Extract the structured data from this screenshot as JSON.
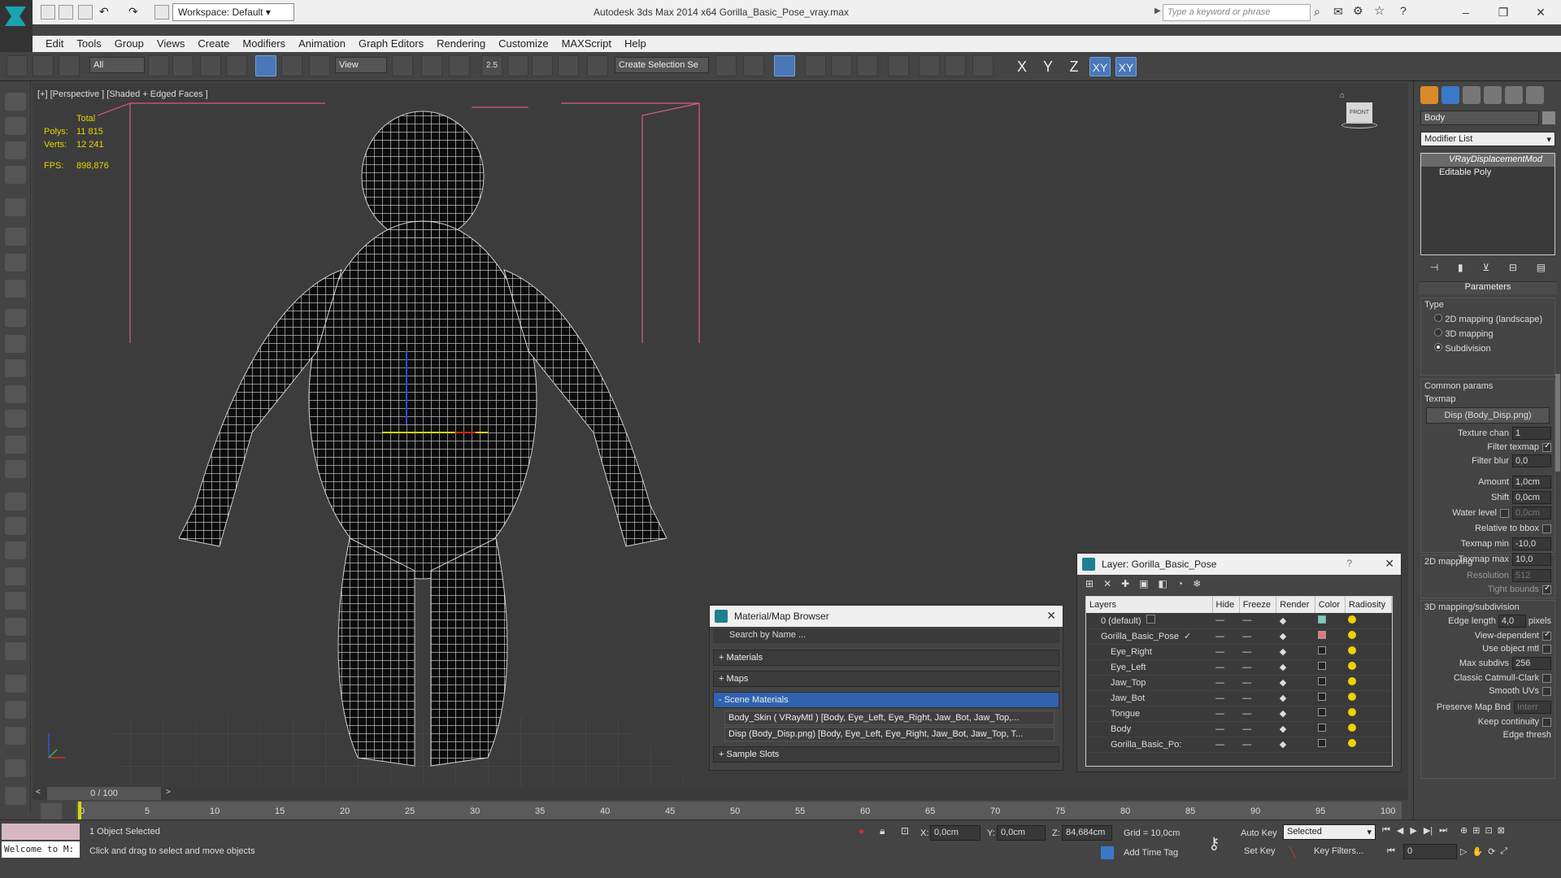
{
  "app": {
    "title": "Autodesk 3ds Max  2014 x64    Gorilla_Basic_Pose_vray.max",
    "workspace": "Workspace: Default",
    "search_placeholder": "Type a keyword or phrase"
  },
  "menu": [
    "Edit",
    "Tools",
    "Group",
    "Views",
    "Create",
    "Modifiers",
    "Animation",
    "Graph Editors",
    "Rendering",
    "Customize",
    "MAXScript",
    "Help"
  ],
  "toolbar": {
    "filter": "All",
    "refcoord": "View",
    "selset": "Create Selection Se",
    "snap2": "2.5",
    "axes": [
      "X",
      "Y",
      "Z",
      "XY",
      "XY"
    ]
  },
  "viewport": {
    "label": "[+] [Perspective ] [Shaded + Edged Faces ]",
    "stats": {
      "total": "Total",
      "polys_label": "Polys:",
      "polys": "11 815",
      "verts_label": "Verts:",
      "verts": "12 241",
      "fps_label": "FPS:",
      "fps": "898,876"
    },
    "viewcube": "FRONT"
  },
  "command_panel": {
    "object_name": "Body",
    "modifier_list": "Modifier List",
    "stack": [
      "VRayDisplacementMod",
      "Editable Poly"
    ],
    "params": {
      "title": "Parameters",
      "type_label": "Type",
      "types": [
        "2D mapping (landscape)",
        "3D mapping",
        "Subdivision"
      ],
      "selected_type": 2,
      "common": "Common params",
      "texmap_label": "Texmap",
      "texmap": "Disp (Body_Disp.png)",
      "texture_chan_label": "Texture chan",
      "texture_chan": "1",
      "filter_texmap": "Filter texmap",
      "filter_blur_label": "Filter blur",
      "filter_blur": "0,0",
      "amount_label": "Amount",
      "amount": "1,0cm",
      "shift_label": "Shift",
      "shift": "0,0cm",
      "water_label": "Water level",
      "water": "0,0cm",
      "relative": "Relative to bbox",
      "texmap_min_label": "Texmap min",
      "texmap_min": "-10,0",
      "texmap_max_label": "Texmap max",
      "texmap_max": "10,0",
      "mapping2d": "2D mapping",
      "resolution_label": "Resolution",
      "resolution": "512",
      "tight": "Tight bounds",
      "mapping3d": "3D mapping/subdivision",
      "edge_label": "Edge length",
      "edge": "4,0",
      "pixels": "pixels",
      "view_dep": "View-dependent",
      "use_obj": "Use object mtl",
      "max_subdivs_label": "Max subdivs",
      "max_subdivs": "256",
      "catmull": "Classic Catmull-Clark",
      "smooth_uvs": "Smooth UVs",
      "preserve_label": "Preserve Map Bnd",
      "preserve": "Interr",
      "keep": "Keep continuity",
      "edge_thresh": "Edge thresh"
    }
  },
  "material_browser": {
    "title": "Material/Map Browser",
    "search": "Search by Name ...",
    "sections": [
      "+ Materials",
      "+ Maps",
      "- Scene Materials",
      "+ Sample Slots"
    ],
    "items": [
      "Body_Skin  ( VRayMtl ) [Body, Eye_Left, Eye_Right, Jaw_Bot, Jaw_Top,...",
      "Disp (Body_Disp.png) [Body, Eye_Left, Eye_Right, Jaw_Bot, Jaw_Top, T..."
    ]
  },
  "layer_panel": {
    "title": "Layer: Gorilla_Basic_Pose",
    "help": "?",
    "headers": [
      "Layers",
      "Hide",
      "Freeze",
      "Render",
      "Color",
      "Radiosity"
    ],
    "rows": [
      {
        "name": "0 (default)",
        "color": "#6fd0c0",
        "indent": 0
      },
      {
        "name": "Gorilla_Basic_Pose",
        "color": "#e07a7a",
        "indent": 0
      },
      {
        "name": "Eye_Right",
        "color": "#222222",
        "indent": 1
      },
      {
        "name": "Eye_Left",
        "color": "#222222",
        "indent": 1
      },
      {
        "name": "Jaw_Top",
        "color": "#222222",
        "indent": 1
      },
      {
        "name": "Jaw_Bot",
        "color": "#222222",
        "indent": 1
      },
      {
        "name": "Tongue",
        "color": "#222222",
        "indent": 1
      },
      {
        "name": "Body",
        "color": "#222222",
        "indent": 1
      },
      {
        "name": "Gorilla_Basic_Po:",
        "color": "#222222",
        "indent": 1
      }
    ]
  },
  "timeline": {
    "frame": "0 / 100",
    "ticks": [
      "0",
      "5",
      "10",
      "15",
      "20",
      "25",
      "30",
      "35",
      "40",
      "45",
      "50",
      "55",
      "60",
      "65",
      "70",
      "75",
      "80",
      "85",
      "90",
      "95",
      "100"
    ]
  },
  "status": {
    "welcome": "Welcome to M:",
    "selected": "1 Object Selected",
    "hint": "Click and drag to select and move objects",
    "x_label": "X:",
    "x": "0,0cm",
    "y_label": "Y:",
    "y": "0,0cm",
    "z_label": "Z:",
    "z": "84,684cm",
    "grid": "Grid = 10,0cm",
    "add_time_tag": "Add Time Tag",
    "auto_key": "Auto Key",
    "set_key": "Set Key",
    "selected_dd": "Selected",
    "key_filters": "Key Filters...",
    "frame": "0"
  }
}
